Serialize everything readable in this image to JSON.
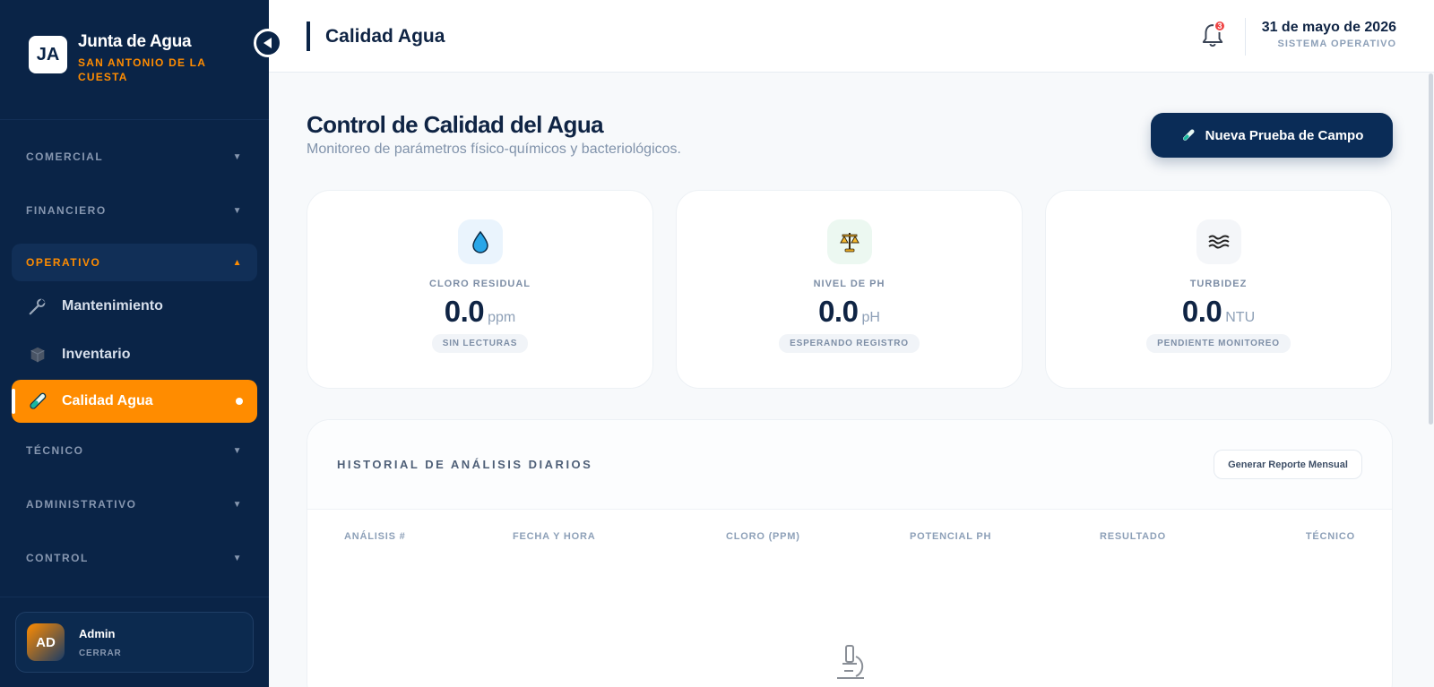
{
  "brand": {
    "logo": "JA",
    "title": "Junta de Agua",
    "subtitle": "SAN ANTONIO DE LA CUESTA"
  },
  "sidebar": {
    "sections": [
      {
        "label": "COMERCIAL",
        "open": false
      },
      {
        "label": "FINANCIERO",
        "open": false
      },
      {
        "label": "OPERATIVO",
        "open": true
      },
      {
        "label": "TÉCNICO",
        "open": false
      },
      {
        "label": "ADMINISTRATIVO",
        "open": false
      },
      {
        "label": "CONTROL",
        "open": false
      }
    ],
    "items": [
      {
        "label": "Mantenimiento",
        "icon": "wrench-icon"
      },
      {
        "label": "Inventario",
        "icon": "box-icon"
      },
      {
        "label": "Calidad Agua",
        "icon": "test-tube-icon",
        "active": true
      }
    ],
    "chevron_down": "▼",
    "chevron_up": "▲"
  },
  "user": {
    "initials": "AD",
    "name": "Admin",
    "logout": "CERRAR"
  },
  "header": {
    "title": "Calidad Agua",
    "notifications": "3",
    "date": "31 de mayo de 2026",
    "status": "SISTEMA OPERATIVO"
  },
  "main": {
    "title": "Control de Calidad del Agua",
    "subtitle": "Monitoreo de parámetros físico-químicos y bacteriológicos.",
    "primary_button": "Nueva Prueba de Campo",
    "cards": [
      {
        "label": "CLORO RESIDUAL",
        "value": "0.0",
        "unit": "ppm",
        "chip": "SIN LECTURAS",
        "icon": "droplet-icon",
        "color": "#eaf4fd"
      },
      {
        "label": "NIVEL DE PH",
        "value": "0.0",
        "unit": "pH",
        "chip": "ESPERANDO REGISTRO",
        "icon": "scales-icon",
        "color": "#ecf8f1"
      },
      {
        "label": "TURBIDEZ",
        "value": "0.0",
        "unit": "NTU",
        "chip": "PENDIENTE MONITOREO",
        "icon": "waves-icon",
        "color": "#f4f6f9"
      }
    ],
    "history": {
      "title": "HISTORIAL DE ANÁLISIS DIARIOS",
      "report_button": "Generar Reporte Mensual",
      "columns": [
        "ANÁLISIS #",
        "FECHA Y HORA",
        "CLORO (PPM)",
        "POTENCIAL PH",
        "RESULTADO",
        "TÉCNICO"
      ]
    }
  },
  "colors": {
    "sidebar": "#0a2447",
    "accent": "#ff8c00",
    "primary": "#0a2c57",
    "badge": "#ef4444"
  }
}
